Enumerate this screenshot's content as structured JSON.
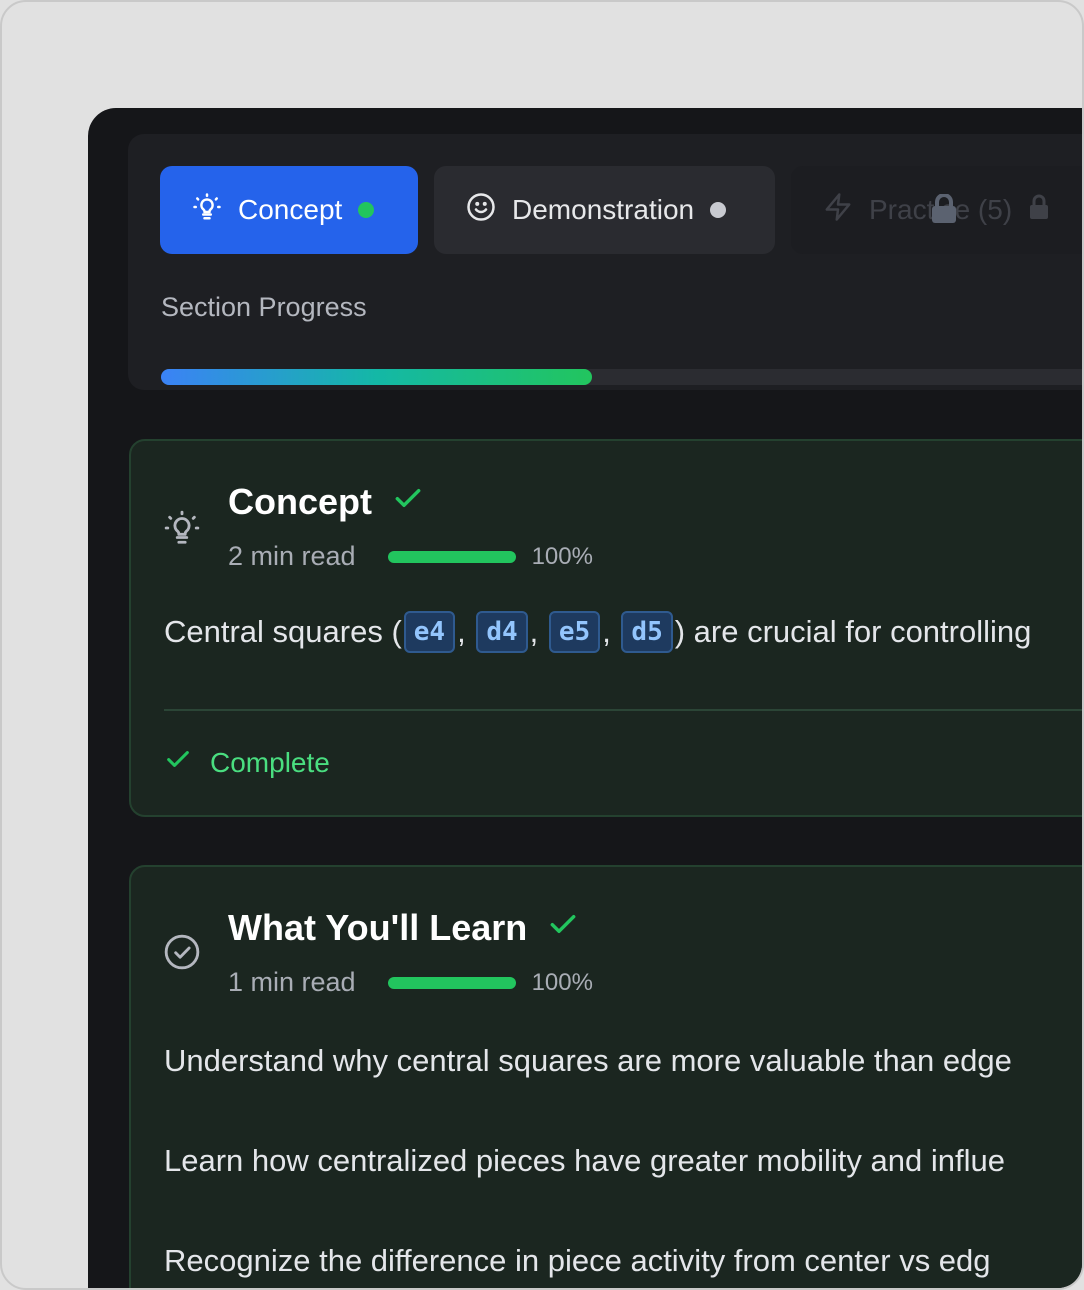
{
  "tabs": [
    {
      "label": "Concept",
      "icon": "lightbulb-icon",
      "status": "active",
      "status_color": "#22c55e"
    },
    {
      "label": "Demonstration",
      "icon": "smile-icon",
      "status": "available",
      "status_color": "#c8cad0"
    },
    {
      "label": "Practice (5)",
      "icon": "lightning-icon",
      "status": "locked"
    }
  ],
  "section_progress": {
    "label": "Section Progress",
    "percent": 44
  },
  "concept_card": {
    "title": "Concept",
    "read_time": "2 min read",
    "progress_label": "100%",
    "progress": 100,
    "body_prefix": "Central squares (",
    "squares": [
      "e4",
      "d4",
      "e5",
      "d5"
    ],
    "body_suffix": ") are crucial for controlling",
    "complete_label": "Complete"
  },
  "learn_card": {
    "title": "What You'll Learn",
    "read_time": "1 min read",
    "progress_label": "100%",
    "progress": 100,
    "items": [
      "Understand why central squares are more valuable than edge",
      "Learn how centralized pieces have greater mobility and influe",
      "Recognize the difference in piece activity from center vs edg"
    ]
  },
  "colors": {
    "accent": "#2563eb",
    "success": "#22c55e",
    "background": "#151619"
  }
}
